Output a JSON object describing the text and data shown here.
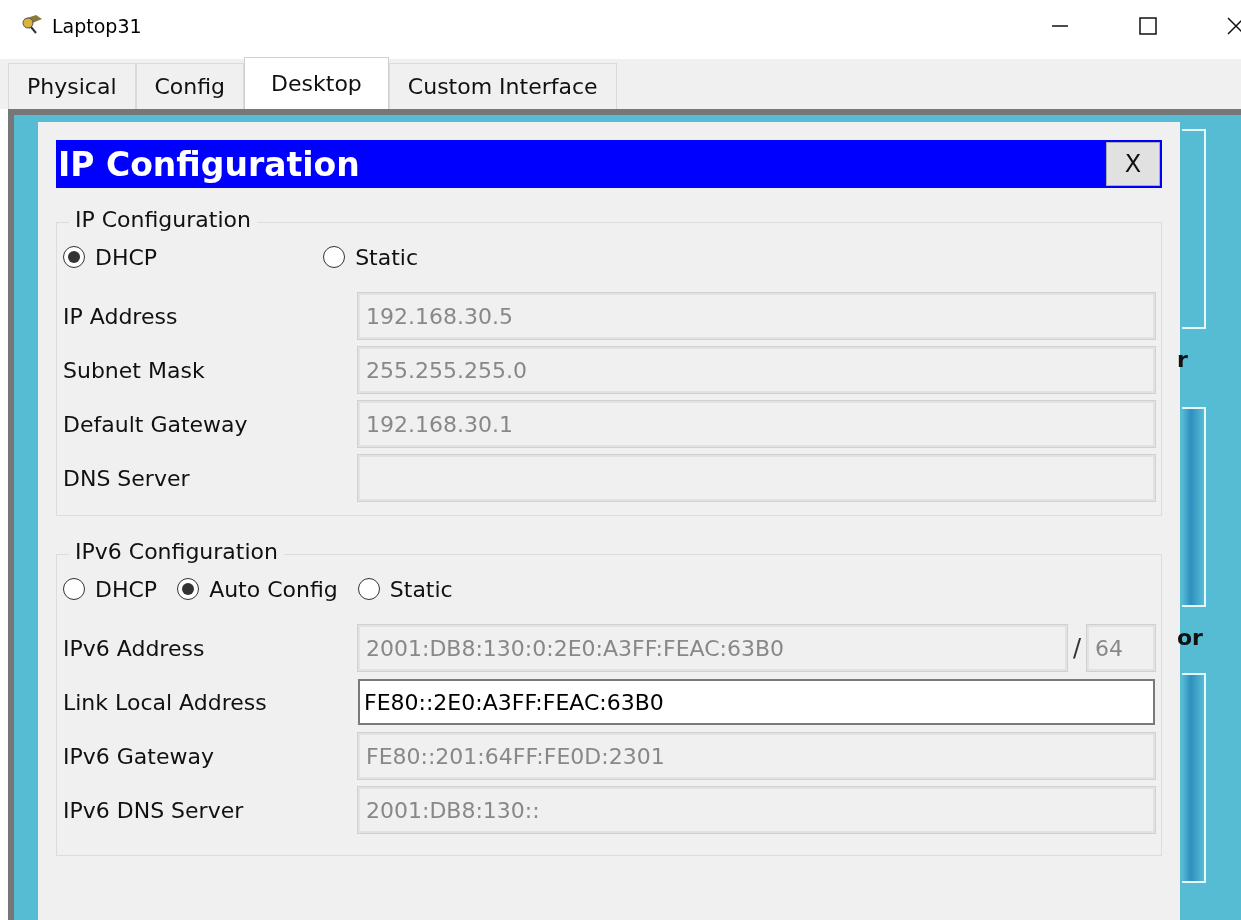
{
  "window": {
    "title": "Laptop31"
  },
  "tabs": [
    {
      "label": "Physical",
      "selected": false
    },
    {
      "label": "Config",
      "selected": false
    },
    {
      "label": "Desktop",
      "selected": true
    },
    {
      "label": "Custom Interface",
      "selected": false
    }
  ],
  "dialog": {
    "title": "IP Configuration",
    "close_label": "X"
  },
  "ipv4": {
    "legend": "IP Configuration",
    "modes": [
      {
        "label": "DHCP",
        "selected": true
      },
      {
        "label": "Static",
        "selected": false
      }
    ],
    "fields": [
      {
        "label": "IP Address",
        "value": "192.168.30.5",
        "disabled": true
      },
      {
        "label": "Subnet Mask",
        "value": "255.255.255.0",
        "disabled": true
      },
      {
        "label": "Default Gateway",
        "value": "192.168.30.1",
        "disabled": true
      },
      {
        "label": "DNS Server",
        "disabled": true
      }
    ]
  },
  "ipv6": {
    "legend": "IPv6 Configuration",
    "modes": [
      {
        "label": "DHCP",
        "selected": false
      },
      {
        "label": "Auto Config",
        "selected": true
      },
      {
        "label": "Static",
        "selected": false
      }
    ],
    "fields": [
      {
        "label": "IPv6 Address",
        "value": "2001:DB8:130:0:2E0:A3FF:FEAC:63B0",
        "disabled": true,
        "separator": "/",
        "prefix": "64"
      },
      {
        "label": "Link Local Address",
        "value": "FE80::2E0:A3FF:FEAC:63B0",
        "disabled": false
      },
      {
        "label": "IPv6 Gateway",
        "value": "FE80::201:64FF:FE0D:2301",
        "disabled": true
      },
      {
        "label": "IPv6 DNS Server",
        "value": "2001:DB8:130::",
        "disabled": true
      }
    ]
  },
  "background_fragments": [
    "r",
    "or"
  ]
}
